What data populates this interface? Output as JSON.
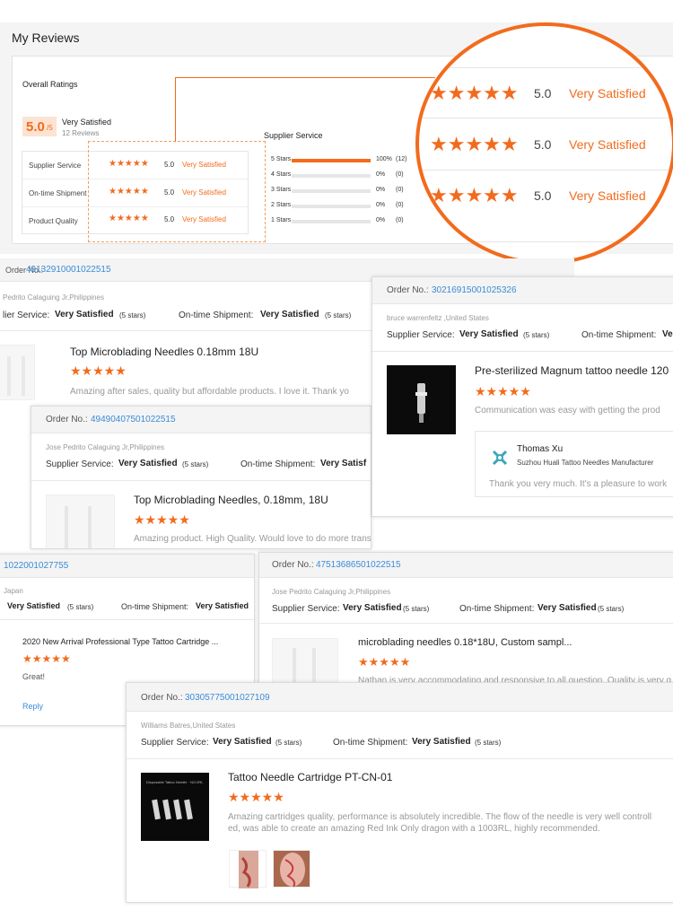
{
  "page": {
    "title": "My Reviews"
  },
  "overall": {
    "label": "Overall Ratings",
    "score": "5.0",
    "score_suffix": "/5",
    "verdict": "Very Satisfied",
    "reviews": "12 Reviews"
  },
  "ratings": [
    {
      "name": "Supplier Service",
      "score": "5.0",
      "verdict": "Very Satisfied",
      "stars": "★★★★★"
    },
    {
      "name": "On-time Shipment",
      "score": "5.0",
      "verdict": "Very Satisfied",
      "stars": "★★★★★"
    },
    {
      "name": "Product Quality",
      "score": "5.0",
      "verdict": "Very Satisfied",
      "stars": "★★★★★"
    }
  ],
  "breakdown": {
    "title": "Supplier Service",
    "rows": [
      {
        "label": "5 Stars",
        "pct": "100%",
        "count": "(12)",
        "fill": 1.0
      },
      {
        "label": "4 Stars",
        "pct": "0%",
        "count": "(0)",
        "fill": 0
      },
      {
        "label": "3 Stars",
        "pct": "0%",
        "count": "(0)",
        "fill": 0
      },
      {
        "label": "2 Stars",
        "pct": "0%",
        "count": "(0)",
        "fill": 0
      },
      {
        "label": "1 Stars",
        "pct": "0%",
        "count": "(0)",
        "fill": 0
      }
    ]
  },
  "zoom": {
    "rows": [
      {
        "stars": "★★★★★",
        "score": "5.0",
        "verdict": "Very Satisfied"
      },
      {
        "stars": "★★★★★",
        "score": "5.0",
        "verdict": "Very Satisfied"
      },
      {
        "stars": "★★★★★",
        "score": "5.0",
        "verdict": "Very Satisfied"
      }
    ],
    "edge": "F"
  },
  "labels": {
    "order": "Order No.:",
    "supplier": "Supplier Service:",
    "shipment": "On-time Shipment:",
    "very": "Very Satisfied",
    "five": "(5 stars)",
    "reply": "Reply",
    "stars": "★★★★★",
    "ve": "Ve"
  },
  "card1": {
    "order": "49132910001022515",
    "user": "Pedrito Calaguing Jr,Philippines",
    "supplier_prefix": "lier Service:",
    "product": "Top Microblading Needles 0.18mm 18U",
    "comment": "Amazing after sales, quality but affordable products. I love it. Thank yo"
  },
  "card2": {
    "order": "30216915001025326",
    "user": "bruce warrenfeltz ,United States",
    "product": "Pre-sterilized Magnum tattoo needle 120",
    "comment": "Communication was easy with getting the prod",
    "replier": "Thomas Xu",
    "company": "Suzhou Huali Tattoo Needles Manufacturer",
    "reply": "Thank you very much. It's a pleasure to work"
  },
  "card3": {
    "order": "49490407501022515",
    "user": "Jose Pedrito Calaguing Jr,Philippines",
    "product": "Top Microblading Needles, 0.18mm, 18U",
    "comment": "Amazing product. High Quality. Would love to do more transactions in the future.",
    "ship_value": "Very Satisf"
  },
  "card4": {
    "order": "1022001027755",
    "user": "Japan",
    "product": "2020 New Arrival Professional Type Tattoo Cartridge ...",
    "comment": "Great!"
  },
  "card5": {
    "order": "47513686501022515",
    "user": "Jose Pedrito Calaguing Jr,Philippines",
    "product": "microblading needles 0.18*18U, Custom sampl...",
    "comment": "Nathan is very accommodating and responsive to all question. Quality is very g"
  },
  "card6": {
    "order": "30305775001027109",
    "user": "Williams Batres,United States",
    "product": "Tattoo Needle Cartridge PT-CN-01",
    "comment1": "Amazing cartridges quality, performance is absolutely incredible. The flow of the needle is very well controll",
    "comment2": "ed, was able to create an amazing Red Ink Only dragon with a 1003RL, highly recommended.",
    "thumb_text": "Disposable Tattoo Needle · NO.0RL"
  },
  "colors": {
    "accent": "#f26b1d",
    "link": "#3b8bd6"
  }
}
